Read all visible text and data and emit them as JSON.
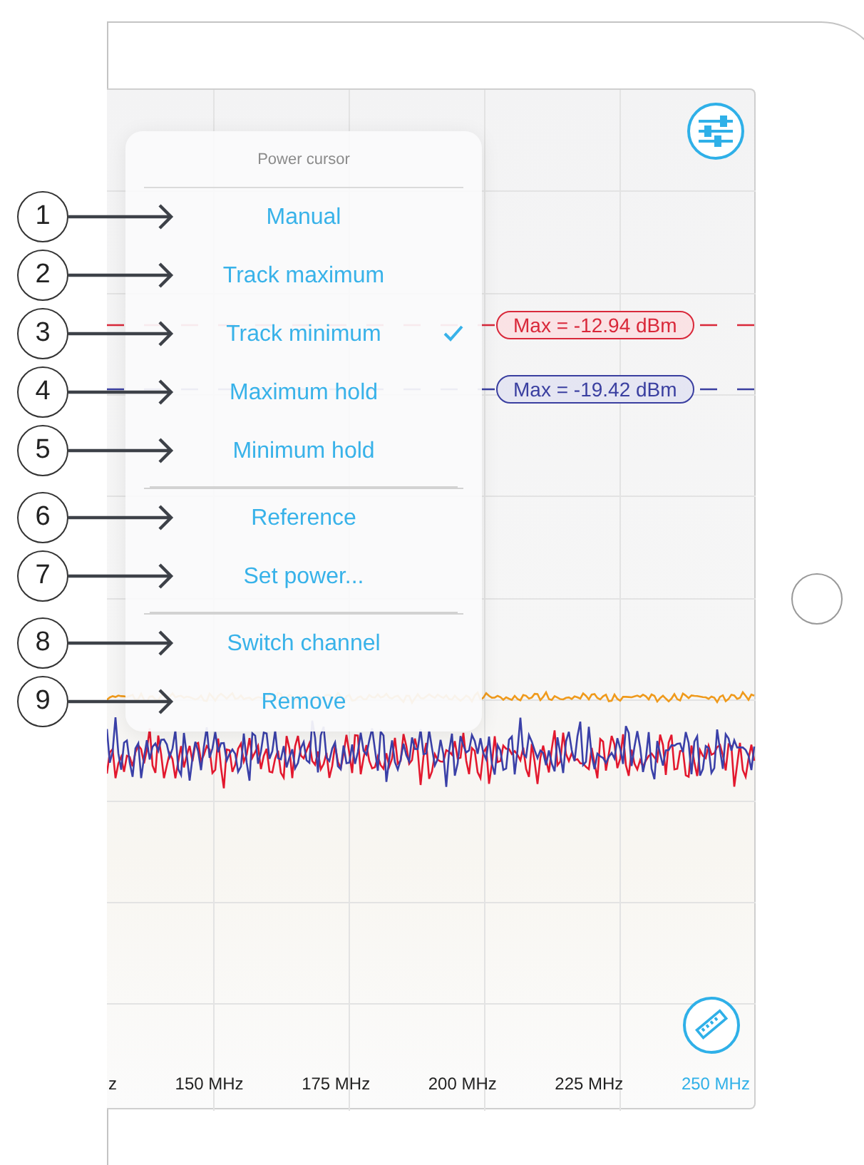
{
  "menu": {
    "title": "Power cursor",
    "groups": [
      {
        "items": [
          {
            "label": "Manual",
            "callout": "1",
            "checked": false
          },
          {
            "label": "Track maximum",
            "callout": "2",
            "checked": false
          },
          {
            "label": "Track minimum",
            "callout": "3",
            "checked": true
          },
          {
            "label": "Maximum hold",
            "callout": "4",
            "checked": false
          },
          {
            "label": "Minimum hold",
            "callout": "5",
            "checked": false
          }
        ]
      },
      {
        "items": [
          {
            "label": "Reference",
            "callout": "6",
            "checked": false
          },
          {
            "label": "Set power...",
            "callout": "7",
            "checked": false
          }
        ]
      },
      {
        "items": [
          {
            "label": "Switch channel",
            "callout": "8",
            "checked": false
          },
          {
            "label": "Remove",
            "callout": "9",
            "checked": false
          }
        ]
      }
    ]
  },
  "markers": [
    {
      "label": "Max = -12.94 dBm",
      "color": "#d9283a"
    },
    {
      "label": "Max = -19.42 dBm",
      "color": "#3a3fa0"
    }
  ],
  "x_axis_labels": [
    {
      "text": "z",
      "highlighted": false
    },
    {
      "text": "150 MHz",
      "highlighted": false
    },
    {
      "text": "175 MHz",
      "highlighted": false
    },
    {
      "text": "200 MHz",
      "highlighted": false
    },
    {
      "text": "225 MHz",
      "highlighted": false
    },
    {
      "text": "250 MHz",
      "highlighted": true
    }
  ]
}
